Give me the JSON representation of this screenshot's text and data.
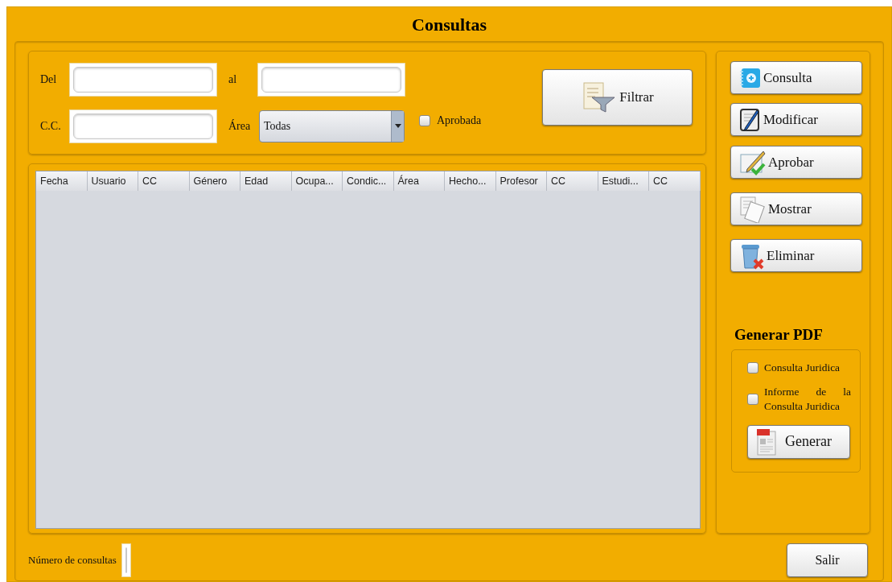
{
  "window": {
    "title": "Consultas"
  },
  "filters": {
    "date_from": {
      "label": "Del"
    },
    "date_to": {
      "label": "al"
    },
    "cc": {
      "label": "C.C."
    },
    "area": {
      "label": "Área",
      "value": "Todas"
    },
    "approved": {
      "label": "Aprobada",
      "checked": false
    },
    "filter_button": "Filtrar"
  },
  "table": {
    "columns": [
      "Fecha",
      "Usuario",
      "CC",
      "Género",
      "Edad",
      "Ocupa...",
      "Condic...",
      "Área",
      "Hecho...",
      "Profesor",
      "CC",
      "Estudi...",
      "CC"
    ]
  },
  "actions": [
    {
      "kind": "new",
      "label": "Consulta"
    },
    {
      "kind": "edit",
      "label": "Modificar"
    },
    {
      "kind": "approve",
      "label": "Aprobar"
    },
    {
      "kind": "show",
      "label": "Mostrar"
    },
    {
      "kind": "delete",
      "label": "Eliminar"
    }
  ],
  "pdf": {
    "title": "Generar PDF",
    "options": [
      {
        "label": "Consulta Juridica",
        "checked": false
      },
      {
        "label": "Informe de la Consulta Juridica",
        "checked": false
      }
    ],
    "button": "Generar"
  },
  "footer": {
    "count_label": "Número de consultas",
    "exit_button": "Salir"
  }
}
